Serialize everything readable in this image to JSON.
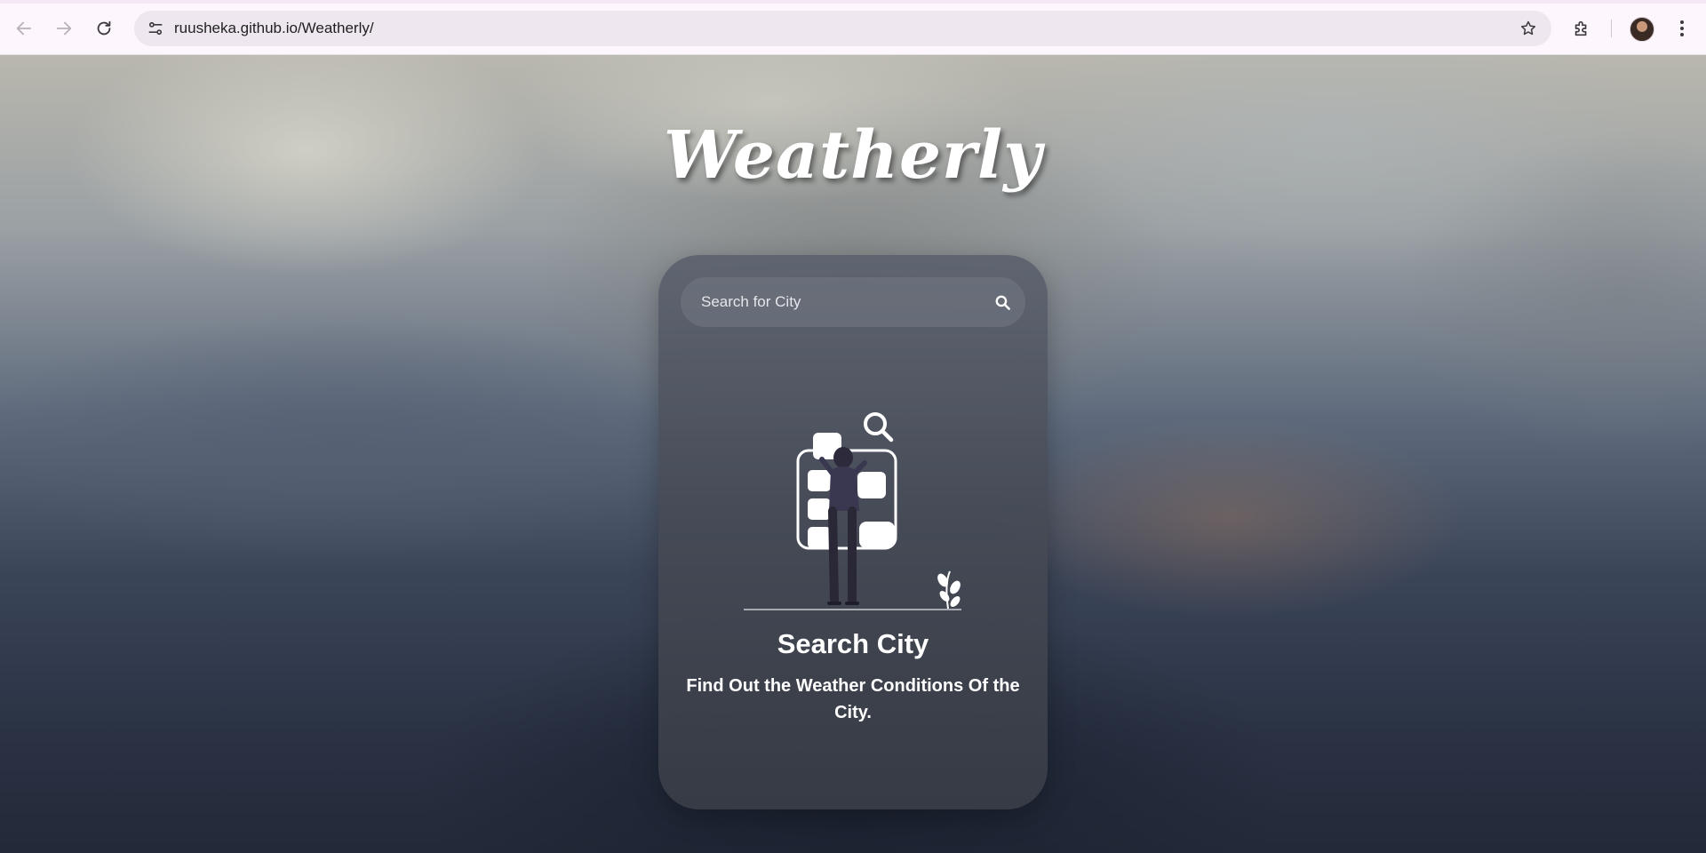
{
  "browser": {
    "url": "ruusheka.github.io/Weatherly/",
    "icons": {
      "back": "arrow-left-icon",
      "forward": "arrow-right-icon",
      "reload": "reload-icon",
      "site_info": "tune-icon",
      "bookmark": "star-icon",
      "extensions": "puzzle-icon",
      "profile": "avatar",
      "menu": "kebab-menu-icon"
    }
  },
  "app": {
    "logo": "Weatherly",
    "search": {
      "placeholder": "Search for City",
      "value": "",
      "button_icon": "search-icon"
    },
    "empty_state": {
      "title": "Search City",
      "subtitle": "Find Out the Weather Conditions Of the City.",
      "illustration": "person-searching-illustration"
    }
  },
  "colors": {
    "chrome_bg": "#fdf6fd",
    "omnibox_bg": "#efe7f0",
    "card_bg": "#4f5461",
    "text_primary": "#ffffff"
  }
}
